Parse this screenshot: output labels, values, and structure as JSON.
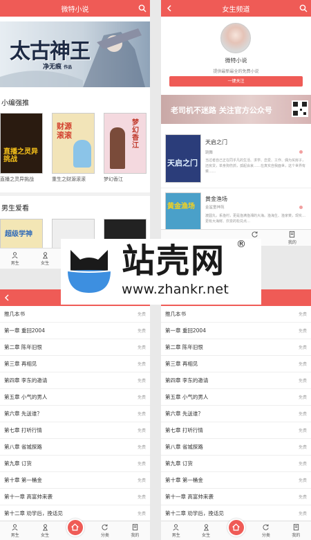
{
  "screen1": {
    "title": "微特小说",
    "banner": {
      "big": "太古神王",
      "author": "净无痕",
      "author_suffix": "作品"
    },
    "section1": "小编强推",
    "books": [
      {
        "name": "直播之灵异挑战",
        "cover_text": "直播之灵异挑战",
        "cover_color": "#2a1b10"
      },
      {
        "name": "重生之财源滚滚",
        "cover_text": "财源滚滚",
        "cover_color": "#f2e4b8"
      },
      {
        "name": "梦幻香江",
        "cover_text": "梦幻香江",
        "cover_color": "#f4d9df"
      }
    ],
    "section2": "男生爱看",
    "books2": [
      {
        "cover_text": "超级学神",
        "cover_color": "#f3e6b5"
      },
      {
        "cover_text": "",
        "cover_color": "#eeeeee"
      },
      {
        "cover_text": "",
        "cover_color": "#222222"
      }
    ],
    "tabs": [
      "男生",
      "女生"
    ]
  },
  "screen2": {
    "title": "女生频道",
    "app_name": "微特小说",
    "tagline": "提供最新最全的免费小说",
    "follow_btn": "一键关注",
    "banner_text": "老司机不迷路 关注官方公众号",
    "books": [
      {
        "title": "天启之门",
        "author": "跳舞",
        "desc": "当过者自己正在同乎凡的生活、求学、恋爱、工作、偶为买房子，还房贷，单身狗伤抓，孤起会哀……在真实自我面世，这个世界有菜……",
        "cover_text": "天启之门",
        "cover_color": "#2b3d7a"
      },
      {
        "title": "黄金渔场",
        "author": "金鲨童神苑",
        "desc": "渡圆丸，系渔村，更是渔满渔湘的大海。渔海生、渔家菜，现实…更有大海鲜、炊泉的松兑点…",
        "cover_text": "黄金渔场",
        "cover_color": "#4aa0c9"
      }
    ],
    "tabs": [
      "书架",
      "我的"
    ]
  },
  "watermark": {
    "brand": "站壳网",
    "url": "www.zhankr.net",
    "reg": "®"
  },
  "chapters": {
    "free": "免费",
    "items": [
      "推几本书",
      "第一章 重回2004",
      "第二章 陈年旧恨",
      "第三章 再相见",
      "第四章 李东的邀请",
      "第五章 小气的男人",
      "第六章 先送谁？",
      "第七章 打听行情",
      "第八章 省城探路",
      "第九章 订货",
      "第十章 第一桶金",
      "第十一章 高富帅来袭",
      "第十二章 劝学后，挽话见"
    ]
  },
  "bottom_tabs": [
    "男生",
    "女生",
    "",
    "分类",
    "我的"
  ]
}
